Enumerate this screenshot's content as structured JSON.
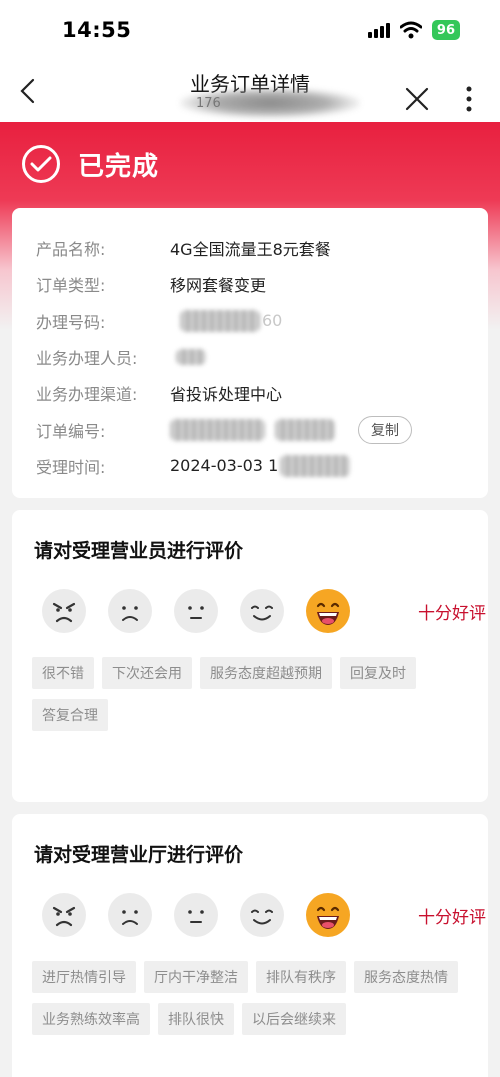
{
  "status_bar": {
    "time": "14:55",
    "battery": "96"
  },
  "nav": {
    "title": "业务订单详情",
    "subtitle": "176"
  },
  "order_status": {
    "text": "已完成"
  },
  "order_info": {
    "rows": [
      {
        "label": "产品名称:",
        "value": "4G全国流量王8元套餐"
      },
      {
        "label": "订单类型:",
        "value": "移网套餐变更"
      },
      {
        "label": "办理号码:",
        "value": "60"
      },
      {
        "label": "业务办理人员:",
        "value": ""
      },
      {
        "label": "业务办理渠道:",
        "value": "省投诉处理中心"
      },
      {
        "label": "订单编号:",
        "value": ""
      },
      {
        "label": "受理时间:",
        "value": "2024-03-03 1"
      }
    ],
    "copy_label": "复制"
  },
  "staff_rating": {
    "title": "请对受理营业员进行评价",
    "result": "十分好评",
    "tags": [
      "很不错",
      "下次还会用",
      "服务态度超越预期",
      "回复及时",
      "答复合理"
    ]
  },
  "hall_rating": {
    "title": "请对受理营业厅进行评价",
    "result": "十分好评",
    "tags": [
      "进厅热情引导",
      "厅内干净整洁",
      "排队有秩序",
      "服务态度热情",
      "业务熟练效率高",
      "排队很快",
      "以后会继续来"
    ]
  },
  "icons": [
    "back-icon",
    "close-icon",
    "more-icon",
    "check-circle-icon",
    "angry-face-icon",
    "sad-face-icon",
    "neutral-face-icon",
    "smile-face-icon",
    "grin-face-icon"
  ],
  "colors": {
    "accent": "#e8203f",
    "rating_text": "#c8102e",
    "battery": "#34c759"
  }
}
